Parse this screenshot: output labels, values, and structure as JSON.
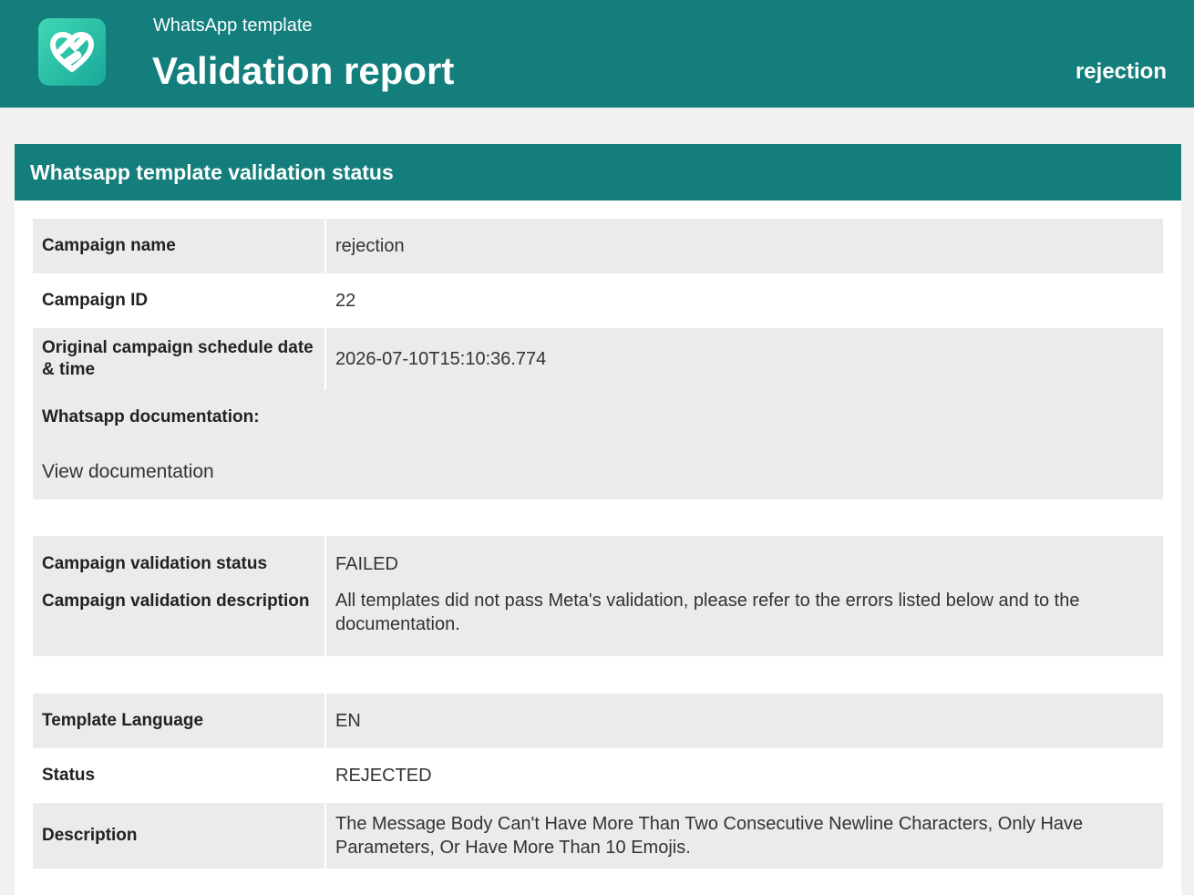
{
  "header": {
    "subtitle": "WhatsApp template",
    "title": "Validation report",
    "campaign_tag": "rejection",
    "brand_color": "#137e7b",
    "logo_icon": "whatsapp-phone-heart-icon"
  },
  "panel": {
    "title": "Whatsapp template validation status"
  },
  "campaign_info": {
    "name_label": "Campaign name",
    "name_value": "rejection",
    "id_label": "Campaign ID",
    "id_value": "22",
    "schedule_label": "Original campaign schedule date & time",
    "schedule_value": "2026-07-10T15:10:36.774",
    "docs_label": "Whatsapp documentation:",
    "docs_link": "View documentation"
  },
  "validation": {
    "status_label": "Campaign validation status",
    "status_value": "FAILED",
    "description_label": "Campaign validation description",
    "description_value": "All templates did not pass Meta's validation, please refer to the errors listed below and to the documentation."
  },
  "template": {
    "language_label": "Template Language",
    "language_value": "EN",
    "status_label": "Status",
    "status_value": "REJECTED",
    "description_label": "Description",
    "description_value": "The Message Body Can't Have More Than Two Consecutive Newline Characters, Only Have Parameters, Or Have More Than 10 Emojis."
  }
}
